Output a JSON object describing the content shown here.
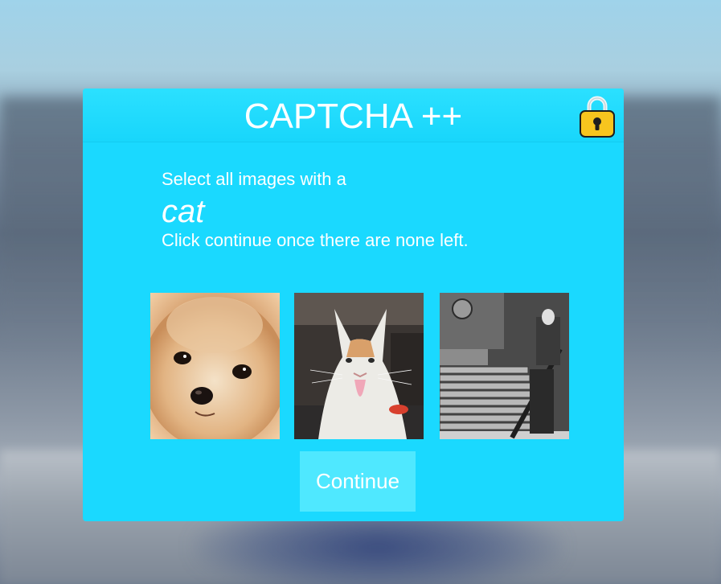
{
  "dialog": {
    "title": "CAPTCHA ++",
    "lock_icon": "padlock-icon",
    "instruction_prefix": "Select all images with a",
    "target": "cat",
    "instruction_suffix": "Click continue once there are none left.",
    "continue_label": "Continue"
  },
  "images": [
    {
      "subject": "dog",
      "icon": "pomeranian-image"
    },
    {
      "subject": "cat",
      "icon": "cat-image"
    },
    {
      "subject": "staircase",
      "icon": "staircase-image"
    }
  ],
  "colors": {
    "dialog_bg": "#1ad9ff",
    "button_bg": "#4fe8ff",
    "text": "#ffffff",
    "lock_body": "#f7c51e"
  }
}
